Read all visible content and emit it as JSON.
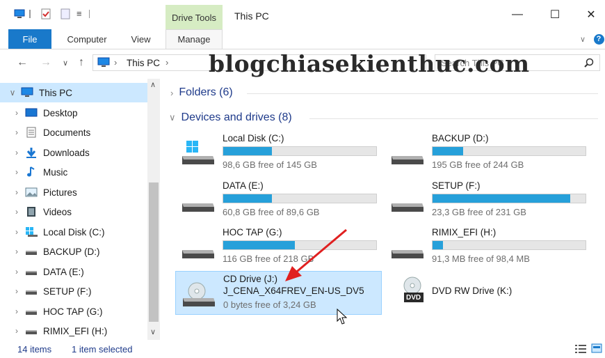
{
  "titlebar": {
    "context_tab_label": "Drive Tools",
    "window_title": "This PC",
    "qa_dropdown": "≡",
    "minimize": "—",
    "maximize": "☐",
    "close": "✕"
  },
  "ribbon": {
    "tabs": [
      "File",
      "Computer",
      "View",
      "Manage"
    ],
    "expand": "∨",
    "help": "?"
  },
  "navbar": {
    "back": "←",
    "forward": "→",
    "recent": "∨",
    "up": "↑",
    "path": [
      "This PC"
    ],
    "path_sep": "›",
    "path_dropdown": "›",
    "search_placeholder": "Search This PC",
    "search_icon": "search-icon"
  },
  "watermark": "blogchiasekienthuc.com",
  "navpane": {
    "items": [
      {
        "label": "This PC",
        "icon": "pc-icon",
        "expanded": true,
        "selected": true
      },
      {
        "label": "Desktop",
        "icon": "desktop-icon"
      },
      {
        "label": "Documents",
        "icon": "documents-icon"
      },
      {
        "label": "Downloads",
        "icon": "downloads-icon"
      },
      {
        "label": "Music",
        "icon": "music-icon"
      },
      {
        "label": "Pictures",
        "icon": "pictures-icon"
      },
      {
        "label": "Videos",
        "icon": "videos-icon"
      },
      {
        "label": "Local Disk (C:)",
        "icon": "windows-drive-icon"
      },
      {
        "label": "BACKUP (D:)",
        "icon": "drive-icon"
      },
      {
        "label": "DATA (E:)",
        "icon": "drive-icon"
      },
      {
        "label": "SETUP (F:)",
        "icon": "drive-icon"
      },
      {
        "label": "HOC TAP (G:)",
        "icon": "drive-icon"
      },
      {
        "label": "RIMIX_EFI (H:)",
        "icon": "drive-icon"
      }
    ],
    "scroll_up": "∧",
    "scroll_down": "∨"
  },
  "content": {
    "folders_header": "Folders (6)",
    "devices_header": "Devices and drives (8)",
    "drives": [
      {
        "name": "Local Disk (C:)",
        "free": "98,6 GB free of 145 GB",
        "used_fraction": 0.32,
        "icon": "windows-drive-icon"
      },
      {
        "name": "BACKUP (D:)",
        "free": "195 GB free of 244 GB",
        "used_fraction": 0.2,
        "icon": "drive-icon"
      },
      {
        "name": "DATA (E:)",
        "free": "60,8 GB free of 89,6 GB",
        "used_fraction": 0.32,
        "icon": "drive-icon"
      },
      {
        "name": "SETUP (F:)",
        "free": "23,3 GB free of 231 GB",
        "used_fraction": 0.9,
        "icon": "drive-icon"
      },
      {
        "name": "HOC TAP (G:)",
        "free": "116 GB free of 218 GB",
        "used_fraction": 0.47,
        "icon": "drive-icon"
      },
      {
        "name": "RIMIX_EFI (H:)",
        "free": "91,3 MB free of 98,4 MB",
        "used_fraction": 0.07,
        "icon": "drive-icon"
      }
    ],
    "cd_drive": {
      "name": "CD Drive (J:)",
      "label": "J_CENA_X64FREV_EN-US_DV5",
      "free": "0 bytes free of 3,24 GB",
      "icon": "cd-drive-icon"
    },
    "dvd_drive": {
      "name": "DVD RW Drive (K:)",
      "icon": "dvd-drive-icon",
      "badge": "DVD"
    }
  },
  "statusbar": {
    "item_count": "14 items",
    "selection": "1 item selected"
  },
  "colors": {
    "accent": "#1979ca",
    "bar_fill": "#26a0da",
    "selection": "#cce8ff",
    "annotation_arrow": "#e02020"
  }
}
